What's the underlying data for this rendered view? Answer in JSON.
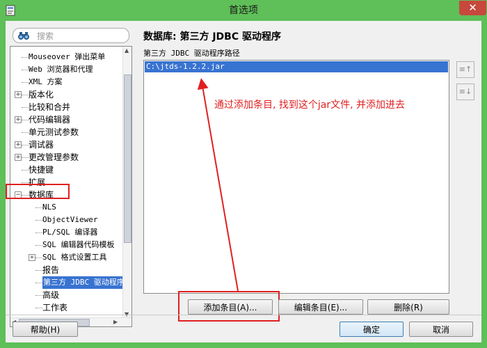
{
  "window": {
    "title": "首选项",
    "close_label": "✕"
  },
  "search": {
    "placeholder": "搜索"
  },
  "tree": {
    "items": [
      {
        "label": "Mouseover 弹出菜单",
        "indent": 1,
        "mono": true,
        "expander": ""
      },
      {
        "label": "Web 浏览器和代理",
        "indent": 1,
        "mono": true,
        "expander": ""
      },
      {
        "label": "XML 方案",
        "indent": 1,
        "mono": true,
        "expander": ""
      },
      {
        "label": "版本化",
        "indent": 1,
        "mono": false,
        "expander": "+"
      },
      {
        "label": "比较和合并",
        "indent": 1,
        "mono": false,
        "expander": ""
      },
      {
        "label": "代码编辑器",
        "indent": 1,
        "mono": false,
        "expander": "+"
      },
      {
        "label": "单元测试参数",
        "indent": 1,
        "mono": false,
        "expander": ""
      },
      {
        "label": "调试器",
        "indent": 1,
        "mono": false,
        "expander": "+"
      },
      {
        "label": "更改管理参数",
        "indent": 1,
        "mono": false,
        "expander": "+"
      },
      {
        "label": "快捷键",
        "indent": 1,
        "mono": false,
        "expander": ""
      },
      {
        "label": "扩展",
        "indent": 1,
        "mono": false,
        "expander": ""
      },
      {
        "label": "数据库",
        "indent": 1,
        "mono": false,
        "expander": "−"
      },
      {
        "label": "NLS",
        "indent": 2,
        "mono": true,
        "expander": ""
      },
      {
        "label": "ObjectViewer",
        "indent": 2,
        "mono": true,
        "expander": ""
      },
      {
        "label": "PL/SQL 编译器",
        "indent": 2,
        "mono": true,
        "expander": ""
      },
      {
        "label": "SQL 编辑器代码模板",
        "indent": 2,
        "mono": true,
        "expander": ""
      },
      {
        "label": "SQL 格式设置工具",
        "indent": 2,
        "mono": true,
        "expander": "+"
      },
      {
        "label": "报告",
        "indent": 2,
        "mono": false,
        "expander": ""
      },
      {
        "label": "第三方 JDBC 驱动程序",
        "indent": 2,
        "mono": true,
        "expander": "",
        "selected": true
      },
      {
        "label": "高级",
        "indent": 2,
        "mono": false,
        "expander": ""
      },
      {
        "label": "工作表",
        "indent": 2,
        "mono": false,
        "expander": ""
      }
    ]
  },
  "panel": {
    "title": "数据库: 第三方 JDBC 驱动程序",
    "subtitle": "第三方 JDBC 驱动程序路径",
    "jar_entries": [
      "C:\\jtds-1.2.2.jar"
    ],
    "up_icon_label": "≡↑",
    "down_icon_label": "≡↓"
  },
  "annotation": {
    "text": "通过添加条目, 找到这个jar文件, 并添加进去",
    "color": "#e02020"
  },
  "buttons": {
    "add_entry": "添加条目(A)...",
    "edit_entry": "编辑条目(E)...",
    "delete": "删除(R)",
    "help": "帮助(H)",
    "ok": "确定",
    "cancel": "取消"
  },
  "colors": {
    "selection": "#3873d1",
    "window_frame": "#5fbf58",
    "close_button": "#c7483c"
  }
}
